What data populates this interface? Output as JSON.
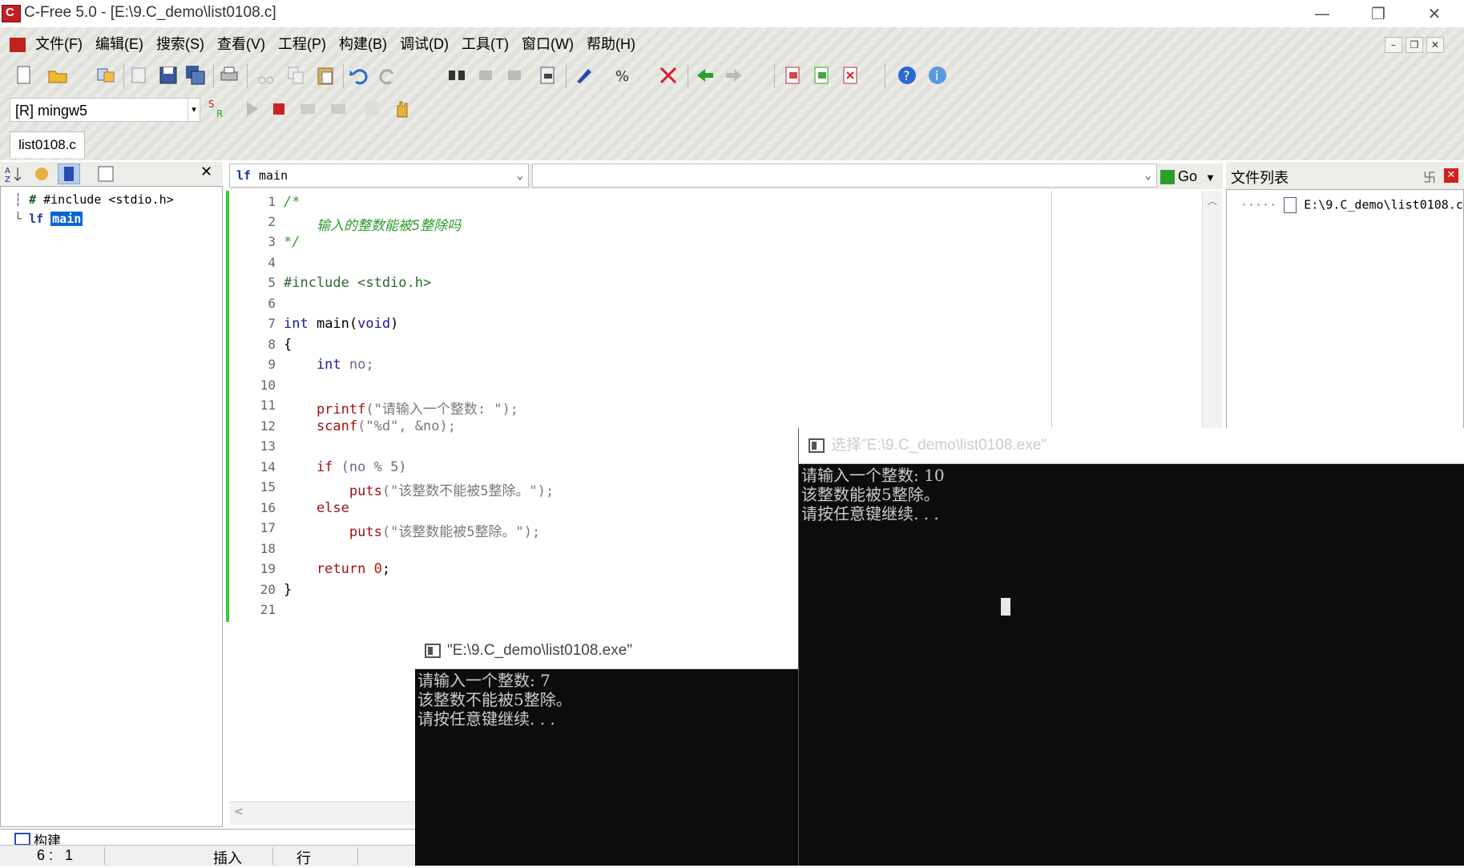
{
  "window": {
    "title": "C-Free 5.0 - [E:\\9.C_demo\\list0108.c]",
    "controls": {
      "minimize": "—",
      "restore": "❐",
      "close": "✕"
    }
  },
  "menu": [
    "文件(F)",
    "编辑(E)",
    "搜索(S)",
    "查看(V)",
    "工程(P)",
    "构建(B)",
    "调试(D)",
    "工具(T)",
    "窗口(W)",
    "帮助(H)"
  ],
  "toolbar": {
    "compiler": "[R] mingw5",
    "go_label": "Go"
  },
  "tabs": {
    "file": "list0108.c"
  },
  "left_panel": {
    "items": [
      {
        "icon": "#",
        "label": "#include <stdio.h>"
      },
      {
        "icon": "lf",
        "label": "main"
      }
    ],
    "build_tab": "构建"
  },
  "editor": {
    "function_combo": "main",
    "function_combo_icon": "lf",
    "line_numbers": [
      "1",
      "2",
      "3",
      "4",
      "5",
      "6",
      "7",
      "8",
      "9",
      "10",
      "11",
      "12",
      "13",
      "14",
      "15",
      "16",
      "17",
      "18",
      "19",
      "20",
      "21"
    ],
    "lines": {
      "l1": "/*",
      "l2": "    输入的整数能被5整除吗",
      "l3": "*/",
      "l5": "#include <stdio.h>",
      "l7_kw": "int",
      "l7_rest": " main(",
      "l7_void": "void",
      "l7_end": ")",
      "l8": "{",
      "l9_kw": "    int",
      "l9_rest": " no;",
      "l11_fn": "    printf",
      "l11_rest": "(\"请输入一个整数: \");",
      "l12_fn": "    scanf",
      "l12_rest": "(\"%d\", &no);",
      "l14_kw": "    if",
      "l14_rest": " (no % 5)",
      "l15_fn": "        puts",
      "l15_rest": "(\"该整数不能被5整除。\");",
      "l16_kw": "    else",
      "l17_fn": "        puts",
      "l17_rest": "(\"该整数能被5整除。\");",
      "l19_kw": "    return",
      "l19_num": " 0",
      "l19_end": ";",
      "l20": "}"
    }
  },
  "file_list": {
    "title": "文件列表",
    "pin": "卐",
    "items": [
      "E:\\9.C_demo\\list0108.c"
    ]
  },
  "status": {
    "pos": "6 :   1",
    "mode": "插入",
    "unit": "行"
  },
  "console_front": {
    "title": "选择\"E:\\9.C_demo\\list0108.exe\"",
    "lines": [
      "请输入一个整数: 10",
      "该整数能被5整除。",
      "请按任意键继续. . ."
    ]
  },
  "console_back": {
    "title": "\"E:\\9.C_demo\\list0108.exe\"",
    "lines": [
      "请输入一个整数: 7",
      "该整数不能被5整除。",
      "请按任意键继续. . ."
    ]
  },
  "colors": {
    "accent_red": "#c0201f",
    "console_bg": "#0c0c0c",
    "select_blue": "#0a64d8"
  }
}
